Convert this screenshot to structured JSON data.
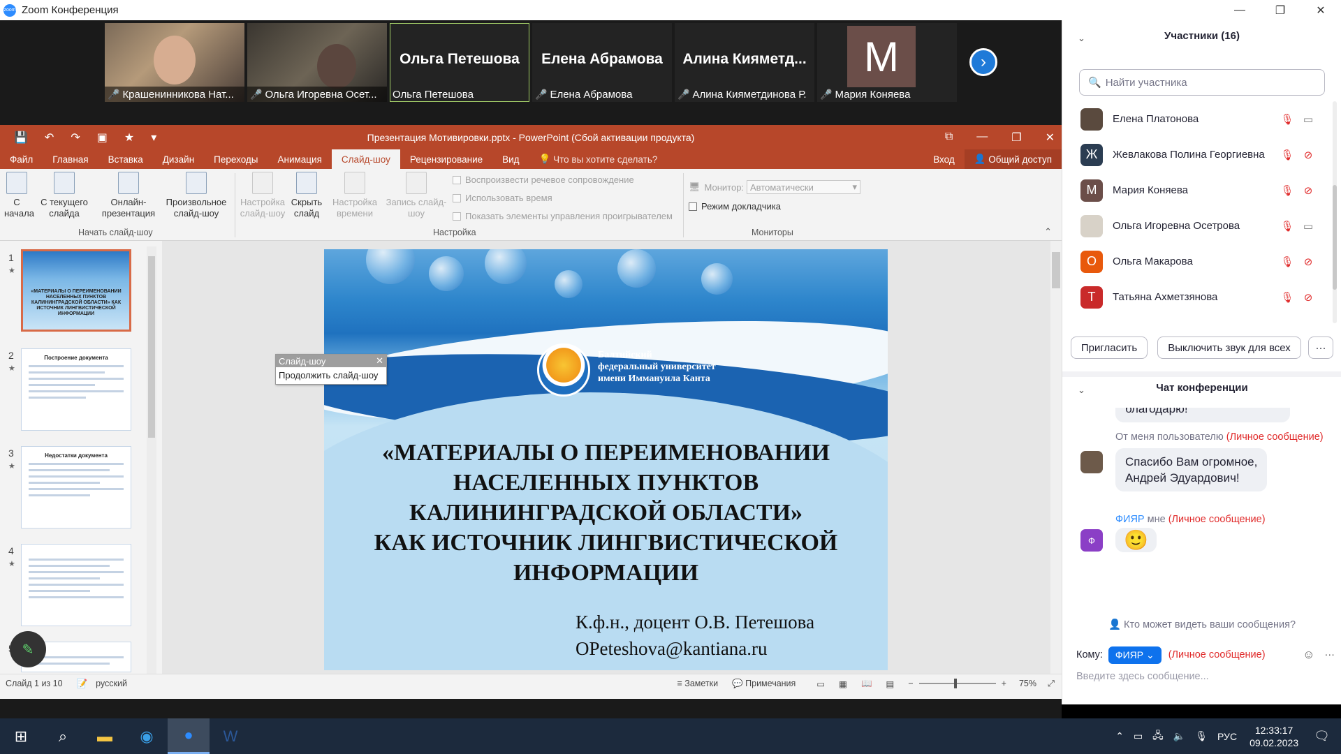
{
  "zoom": {
    "title": "Zoom Конференция",
    "logo": "zoom",
    "window_controls": [
      "—",
      "❐",
      "✕"
    ]
  },
  "video_tiles": [
    {
      "label": "Крашенинникова Нат...",
      "type": "photo",
      "muted": true
    },
    {
      "label": "Ольга Игоревна Осет...",
      "type": "photo",
      "muted": true
    },
    {
      "name": "Ольга Петешова",
      "label": "Ольга Петешова",
      "type": "name",
      "muted": false,
      "active": true
    },
    {
      "name": "Елена Абрамова",
      "label": "Елена Абрамова",
      "type": "name",
      "muted": true
    },
    {
      "name": "Алина  Кияметд...",
      "label": "Алина Кияметдинова Р.",
      "type": "name",
      "muted": true
    },
    {
      "avatar_letter": "M",
      "label": "Мария Коняева",
      "type": "avatar",
      "muted": true,
      "avatar_color": "#6b4e49"
    }
  ],
  "ppt": {
    "title": "Презентация Мотивировки.pptx - PowerPoint (Сбой активации продукта)",
    "tabs": [
      "Файл",
      "Главная",
      "Вставка",
      "Дизайн",
      "Переходы",
      "Анимация",
      "Слайд-шоу",
      "Рецензирование",
      "Вид"
    ],
    "active_tab": "Слайд-шоу",
    "help": "Что вы хотите сделать?",
    "login": "Вход",
    "share": "Общий доступ",
    "ribbon": {
      "from_start_1": "С",
      "from_start_2": "начала",
      "from_current_1": "С текущего",
      "from_current_2": "слайда",
      "online_1": "Онлайн-",
      "online_2": "презентация",
      "custom_1": "Произвольное",
      "custom_2": "слайд-шоу",
      "group_start": "Начать слайд-шоу",
      "setup_1": "Настройка",
      "setup_2": "слайд-шоу",
      "hide_1": "Скрыть",
      "hide_2": "слайд",
      "timing_1": "Настройка",
      "timing_2": "времени",
      "record_1": "Запись слайд-",
      "record_2": "шоу",
      "group_setup": "Настройка",
      "chk_narration": "Воспроизвести речевое сопровождение",
      "chk_timings": "Использовать время",
      "chk_controls": "Показать элементы управления проигрывателем",
      "monitor_label": "Монитор:",
      "monitor_value": "Автоматически",
      "presenter_view": "Режим докладчика",
      "group_monitors": "Мониторы"
    },
    "popup": {
      "title": "Слайд-шоу",
      "action": "Продолжить слайд-шоу"
    },
    "thumbs": [
      {
        "num": "1",
        "selected": true,
        "text": "«МАТЕРИАЛЫ О ПЕРЕИМЕНОВАНИИ НАСЕЛЕННЫХ ПУНКТОВ КАЛИНИНГРАДСКОЙ ОБЛАСТИ» КАК ИСТОЧНИК ЛИНГВИСТИЧЕСКОЙ ИНФОРМАЦИИ"
      },
      {
        "num": "2",
        "selected": false,
        "text": "Построение документа"
      },
      {
        "num": "3",
        "selected": false,
        "text": "Недостатки документа"
      },
      {
        "num": "4",
        "selected": false,
        "text": ""
      },
      {
        "num": "5",
        "selected": false,
        "text": ""
      }
    ],
    "slide": {
      "uni_1": "Балтийский",
      "uni_2": "федеральный университет",
      "uni_3": "имени Иммануила Канта",
      "title_1": "«МАТЕРИАЛЫ О ПЕРЕИМЕНОВАНИИ",
      "title_2": "НАСЕЛЕННЫХ ПУНКТОВ",
      "title_3": "КАЛИНИНГРАДСКОЙ ОБЛАСТИ»",
      "title_4": "КАК ИСТОЧНИК ЛИНГВИСТИЧЕСКОЙ",
      "title_5": "ИНФОРМАЦИИ",
      "author": "К.ф.н., доцент О.В. Петешова",
      "email": "OPeteshova@kantiana.ru"
    },
    "status": {
      "slide_of": "Слайд 1 из 10",
      "lang": "русский",
      "notes": "Заметки",
      "comments": "Примечания",
      "zoom_pct": "75%",
      "zoom_minus": "−",
      "zoom_plus": "+"
    }
  },
  "participants": {
    "header": "Участники (16)",
    "search_placeholder": "Найти участника",
    "list": [
      {
        "name": "Елена Платонова",
        "letter": "",
        "color": "#5a4a3e",
        "cam_on": true
      },
      {
        "name": "Жевлакова Полина Георгиевна",
        "letter": "Ж",
        "color": "#2b3d52",
        "cam_on": false
      },
      {
        "name": "Мария Коняева",
        "letter": "M",
        "color": "#6b4e49",
        "cam_on": false
      },
      {
        "name": "Ольга Игоревна Осетрова",
        "letter": "",
        "color": "#d8d2c8",
        "cam_on": true
      },
      {
        "name": "Ольга Макарова",
        "letter": "О",
        "color": "#e8590c",
        "cam_on": false
      },
      {
        "name": "Татьяна Ахметзянова",
        "letter": "Т",
        "color": "#c92a2a",
        "cam_on": false
      }
    ],
    "invite": "Пригласить",
    "mute_all": "Выключить звук для всех",
    "more": "···"
  },
  "chat": {
    "header": "Чат конференции",
    "prev_bubble": "благодарю!",
    "msg1_from": "От меня пользователю",
    "msg1_priv": "(Личное сообщение)",
    "msg1_text_1": "Спасибо Вам огромное,",
    "msg1_text_2": "Андрей Эдуардович!",
    "msg2_from": "ФИЯР",
    "msg2_to": "мне",
    "msg2_priv": "(Личное сообщение)",
    "msg2_avatar": "Ф",
    "msg2_emoji": "🙂",
    "who_can_see": "Кто может видеть ваши сообщения?",
    "to_label": "Кому:",
    "to_value": "ФИЯР",
    "to_priv": "(Личное сообщение)",
    "input_placeholder": "Введите здесь сообщение..."
  },
  "taskbar": {
    "lang": "РУС",
    "time": "12:33:17",
    "date": "09.02.2023"
  }
}
